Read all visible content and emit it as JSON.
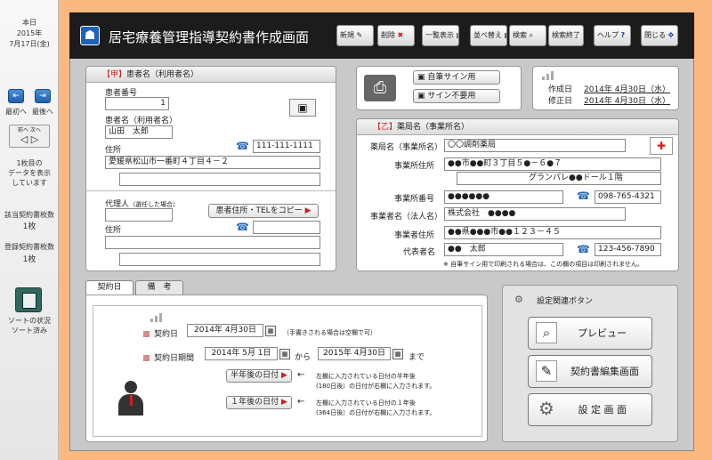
{
  "sidebar": {
    "today_label": "本日",
    "year": "2015年",
    "date": "7月17日(金)",
    "first_label": "最初へ",
    "last_label": "最後へ",
    "page_btn_top": "前へ 次へ",
    "page_info": [
      "1枚目の",
      "データを表示",
      "しています"
    ],
    "contract_count_label": "該当契約書枚数",
    "contract_count": "1枚",
    "registered_count_label": "登録契約書枚数",
    "registered_count": "1枚",
    "sort_status_label": "ソートの状況",
    "sort_status": "ソート済み"
  },
  "header": {
    "title": "居宅療養管理指導契約書作成画面",
    "buttons": {
      "new": "新規",
      "delete": "削除",
      "list": "一覧表示",
      "sort": "並べ替え",
      "search": "検索",
      "search_end": "検索終了",
      "help": "ヘルプ",
      "close": "閉じる"
    }
  },
  "patient": {
    "heading_mark": "【甲】",
    "heading": "患者名（利用者名）",
    "number_label": "患者番号",
    "number": "1",
    "name_label": "患者名（利用者名）",
    "name": "山田　太郎",
    "address_label": "住所",
    "phone": "111-111-1111",
    "address": "愛媛県松山市一番町４丁目４－２",
    "address2": "",
    "agent_label": "代理人",
    "agent_note": "（選任した場合）",
    "copy_button": "患者住所・TELをコピー",
    "agent_name": "",
    "agent_address_label": "住所",
    "agent_phone": "",
    "agent_address": "",
    "agent_address2": ""
  },
  "sign": {
    "with_sign": "自筆サイン用",
    "no_sign": "サイン不要用"
  },
  "dates": {
    "created_label": "作成日",
    "created": "2014年 4月30日（水）",
    "modified_label": "修正日",
    "modified": "2014年 4月30日（水）"
  },
  "pharmacy": {
    "heading_mark": "【乙】",
    "heading": "薬局名（事業所名）",
    "name_label": "薬局名（事業所名）",
    "name": "〇〇調剤薬局",
    "address_label": "事業所住所",
    "address": "●●市●●町３丁目５●－６●７",
    "address2": "グランパレ●●ドール１階",
    "number_label": "事業所番号",
    "number": "●●●●●●",
    "phone": "098-765-4321",
    "corp_label": "事業者名（法人名）",
    "corp": "株式会社　●●●●",
    "corp_address_label": "事業者住所",
    "corp_address": "●●県●●●市●●１２３－４５",
    "rep_label": "代表者名",
    "rep": "●●　太郎",
    "rep_phone": "123-456-7890",
    "note": "※ 自筆サイン用で印刷される場合は、この欄の項目は印刷されません。"
  },
  "tabs": {
    "contract": "契約日",
    "notes": "備　考"
  },
  "contract": {
    "date_label": "契約日",
    "date": "2014年 4月30日",
    "date_note": "（手書きされる場合は空欄で可）",
    "period_label": "契約日期間",
    "period_from": "2014年 5月 1日",
    "from_label": "から",
    "period_to": "2015年 4月30日",
    "to_label": "まで",
    "half_year_button": "半年後の日付",
    "half_year_note1": "左欄に入力されている日付の半年後",
    "half_year_note2": "(180日後）の日付が右欄に入力されます。",
    "one_year_button": "１年後の日付",
    "one_year_note1": "左欄に入力されている日付の１年後",
    "one_year_note2": "(364日後）の日付が右欄に入力されます。"
  },
  "settings": {
    "heading": "設定関連ボタン",
    "preview": "プレビュー",
    "edit": "契約書編集画面",
    "settings": "設 定 画 面"
  },
  "colors": {
    "background": "#fbb880",
    "header": "#1c1c1c",
    "accent_red": "#cc1f1f"
  }
}
